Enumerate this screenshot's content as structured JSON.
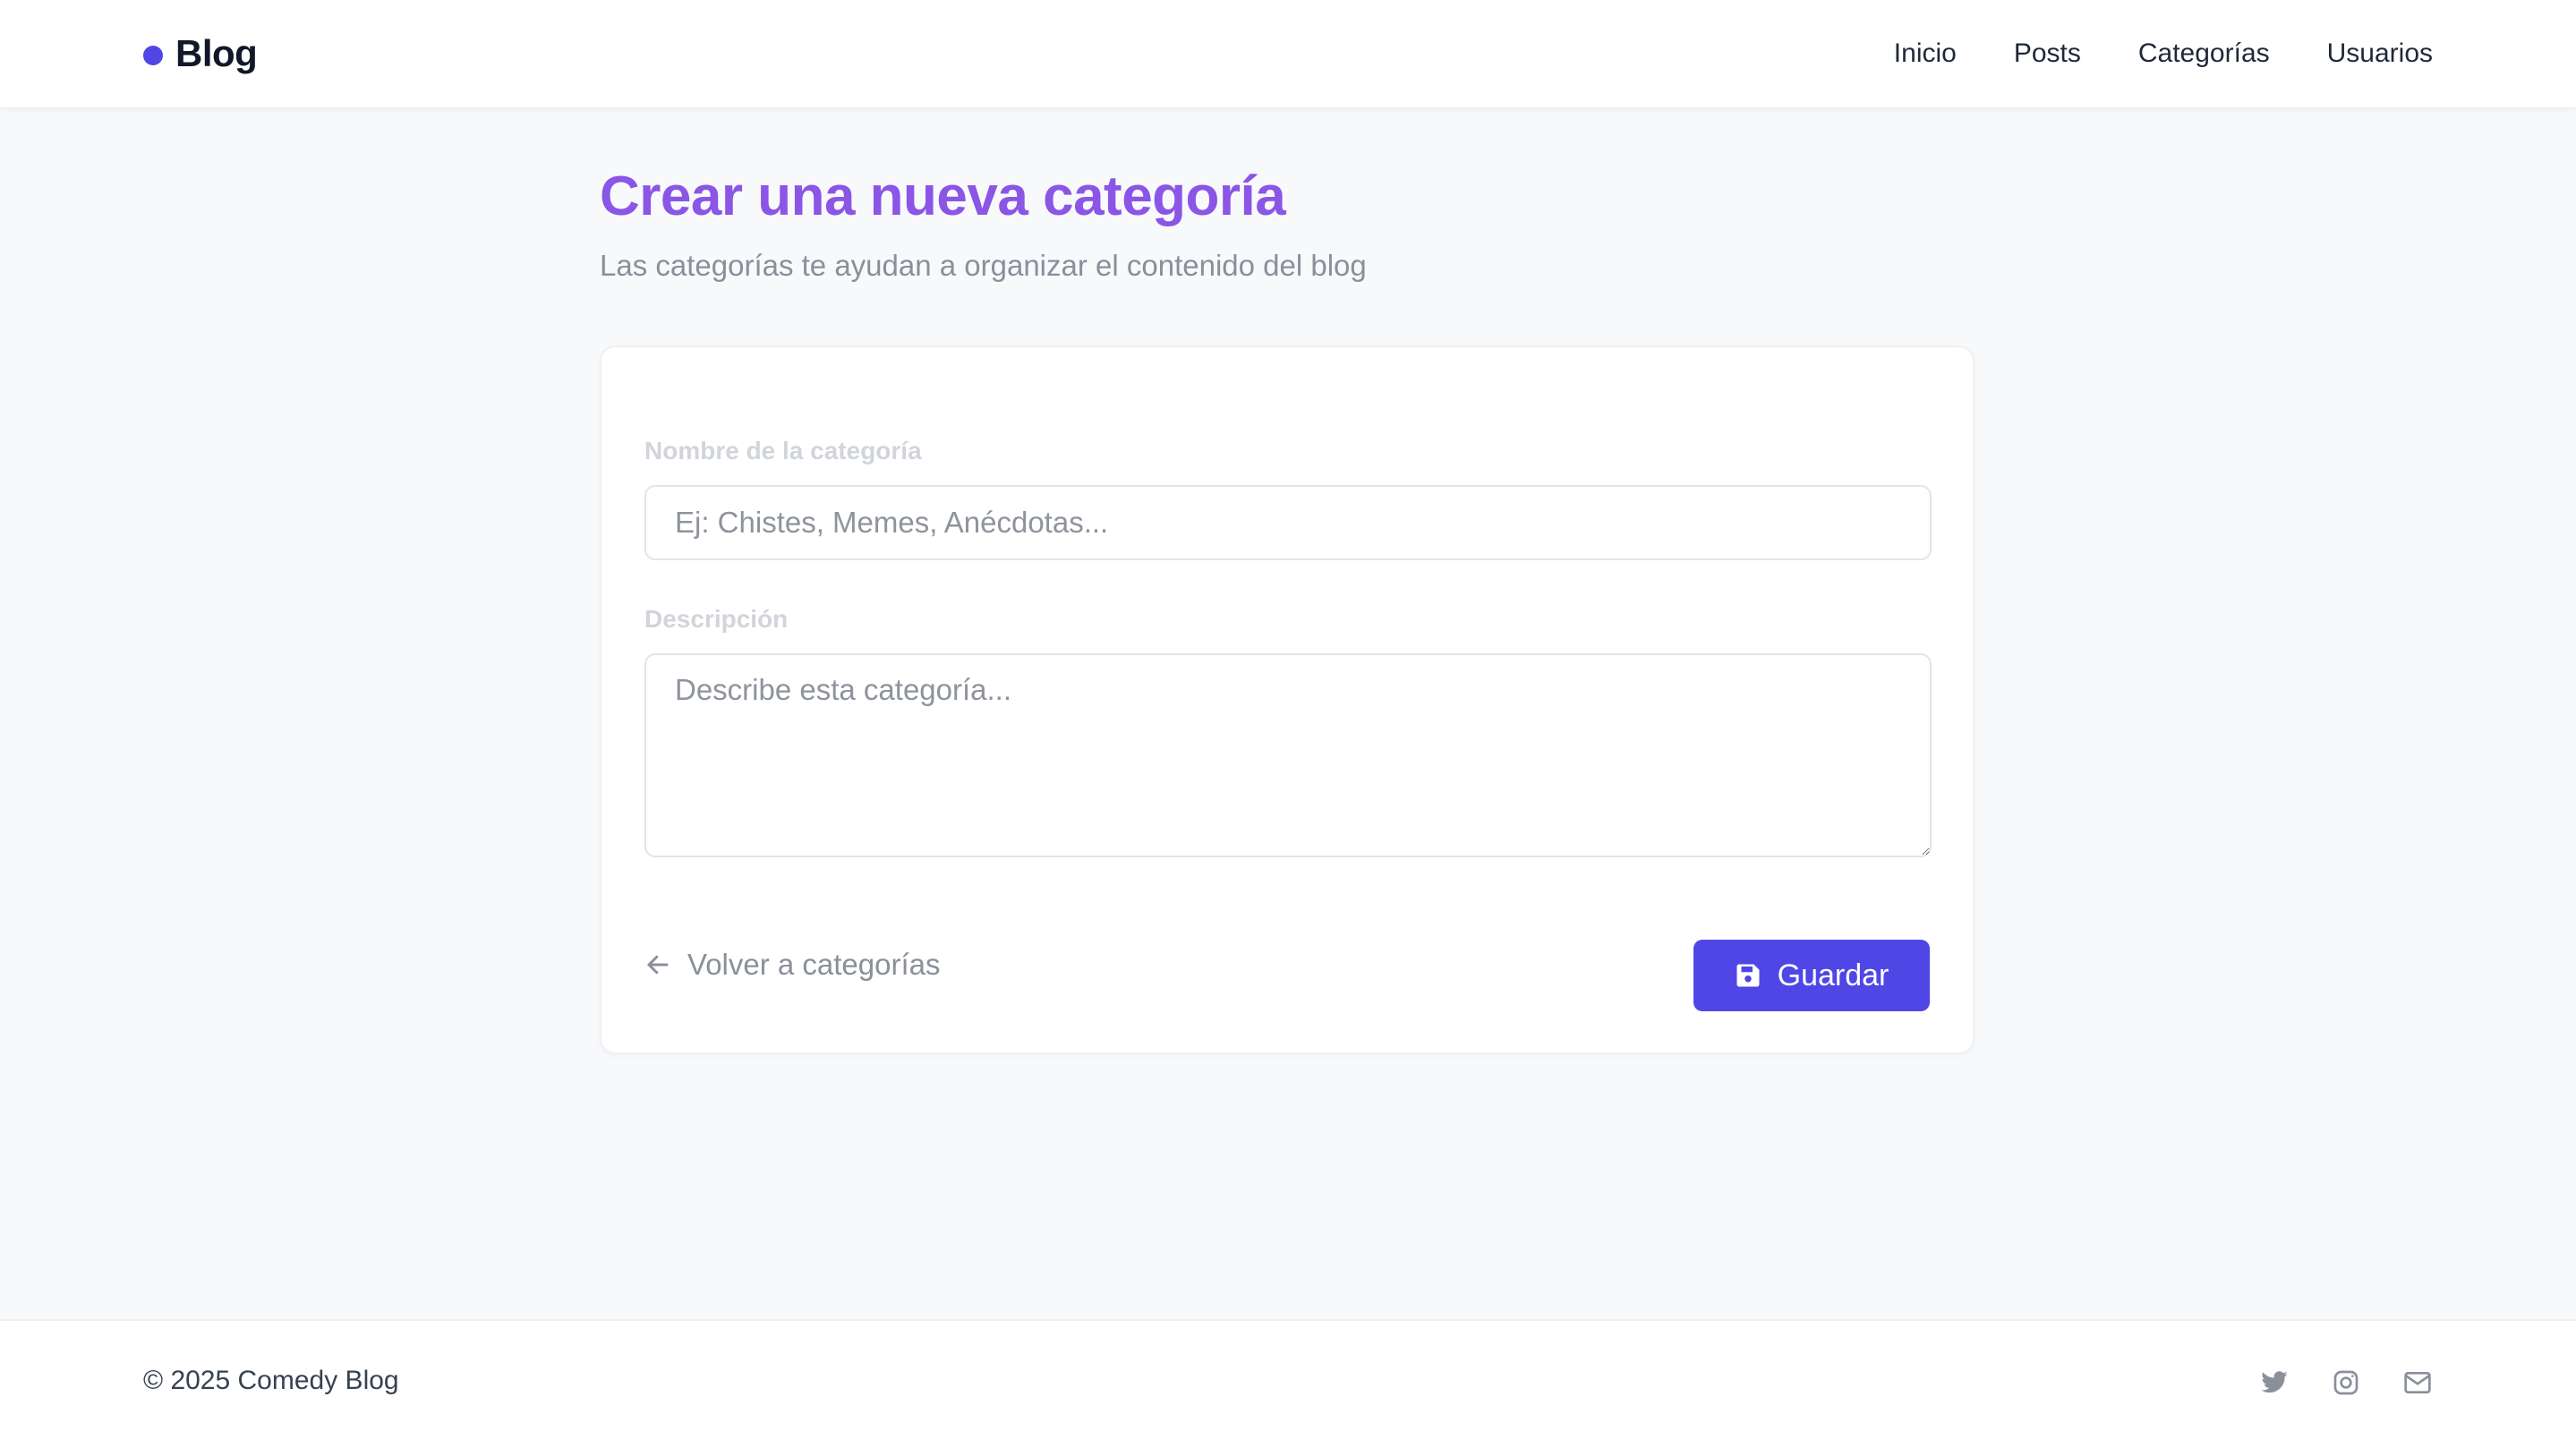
{
  "header": {
    "brand": "Blog",
    "nav": [
      {
        "label": "Inicio"
      },
      {
        "label": "Posts"
      },
      {
        "label": "Categorías"
      },
      {
        "label": "Usuarios"
      }
    ]
  },
  "main": {
    "title": "Crear una nueva categoría",
    "subtitle": "Las categorías te ayudan a organizar el contenido del blog"
  },
  "form": {
    "name_label": "Nombre de la categoría",
    "name_placeholder": "Ej: Chistes, Memes, Anécdotas...",
    "name_value": "",
    "desc_label": "Descripción",
    "desc_placeholder": "Describe esta categoría...",
    "desc_value": "",
    "back_label": "Volver a categorías",
    "save_label": "Guardar"
  },
  "footer": {
    "copyright": "© 2025 Comedy Blog",
    "socials": [
      "twitter-icon",
      "instagram-icon",
      "mail-icon"
    ]
  },
  "colors": {
    "accent": "#4f46e5",
    "title": "#8b55e6"
  }
}
